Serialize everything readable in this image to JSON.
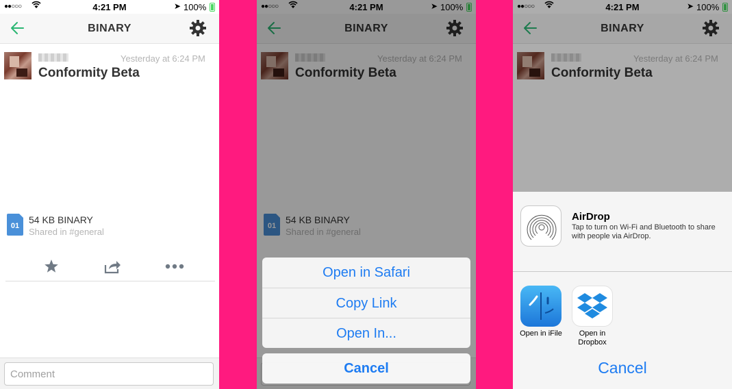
{
  "status_bar": {
    "signal": "●●○○○",
    "time": "4:21 PM",
    "battery": "100%"
  },
  "nav": {
    "title": "BINARY"
  },
  "message": {
    "timestamp": "Yesterday at 6:24 PM",
    "title": "Conformity Beta"
  },
  "file": {
    "icon_text": "01",
    "name": "54 KB BINARY",
    "shared": "Shared in #general"
  },
  "comment": {
    "placeholder": "Comment"
  },
  "action_sheet": {
    "items": [
      "Open in Safari",
      "Copy Link",
      "Open In..."
    ],
    "cancel": "Cancel"
  },
  "share_sheet": {
    "airdrop_title": "AirDrop",
    "airdrop_desc": "Tap to turn on Wi-Fi and Bluetooth to share with people via AirDrop.",
    "apps": [
      {
        "label": "Open in iFile",
        "icon": "ifile-icon"
      },
      {
        "label": "Open in Dropbox",
        "icon": "dropbox-icon"
      }
    ],
    "cancel": "Cancel"
  },
  "colors": {
    "accent_green": "#2bb673",
    "ios_blue": "#1e7cf2",
    "divider_pink": "#ff1a7f"
  }
}
